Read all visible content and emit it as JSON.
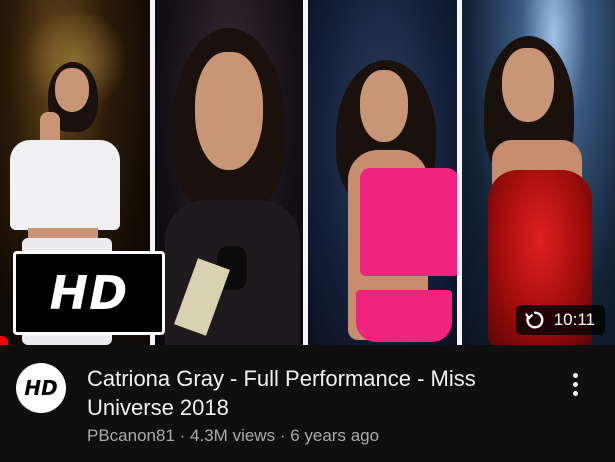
{
  "thumbnail": {
    "badge_text": "HD",
    "duration": "10:11",
    "replay_icon": "replay-icon"
  },
  "video": {
    "title": "Catriona Gray - Full Performance - Miss Universe 2018",
    "channel": "PBcanon81",
    "views": "4.3M views",
    "age": "6 years ago",
    "separator": "·",
    "channel_avatar_text": "HD"
  },
  "colors": {
    "background": "#0f0f0f",
    "progress": "#ff0000",
    "secondary_text": "#aaaaaa"
  }
}
